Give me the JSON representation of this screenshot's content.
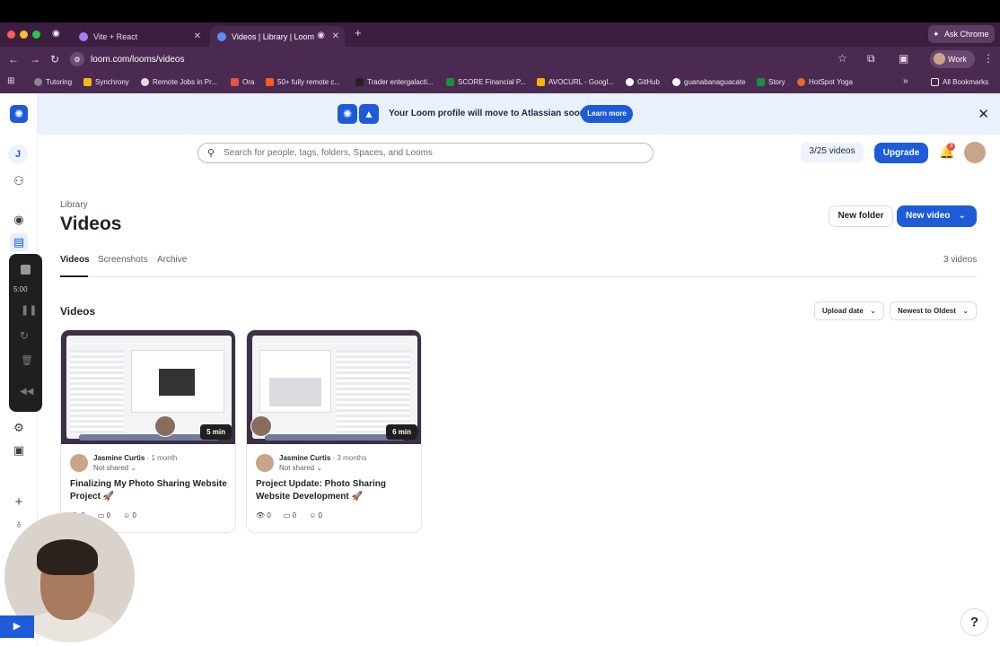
{
  "browser": {
    "tabs": [
      {
        "label": "Vite + React"
      },
      {
        "label": "Videos | Library | Loom"
      }
    ],
    "url": "loom.com/looms/videos",
    "ask_chrome": "Ask Chrome",
    "profile": "Work",
    "bookmarks": [
      "Tutoring",
      "Synchrony",
      "Remote Jobs in Pr...",
      "Ora",
      "50+ fully remote c...",
      "Trader entergalacti...",
      "SCORE Financial P...",
      "AVOCURL - Googl...",
      "GitHub",
      "guanabanaguacate",
      "Story",
      "HotSpot Yoga"
    ],
    "all_bookmarks": "All Bookmarks"
  },
  "rail": {
    "user_initial": "J",
    "timer": "5:00"
  },
  "banner": {
    "message": "Your Loom profile will move to Atlassian soon.",
    "learn_more": "Learn more"
  },
  "header": {
    "search_placeholder": "Search for people, tags, folders, Spaces, and Looms",
    "videos_quota": "3/25 videos",
    "upgrade": "Upgrade",
    "notification_count": "3"
  },
  "page": {
    "breadcrumb": "Library",
    "title": "Videos",
    "new_folder": "New folder",
    "new_video": "New video",
    "subtabs": [
      "Videos",
      "Screenshots",
      "Archive"
    ],
    "count_label": "3 videos",
    "section_title": "Videos",
    "sort_by": "Upload date",
    "sort_order": "Newest to Oldest"
  },
  "videos": [
    {
      "duration": "5 min",
      "author": "Jasmine Curtis",
      "when": "1 month",
      "sharing": "Not shared",
      "title": "Finalizing My Photo Sharing Website Project 🚀",
      "views": "0",
      "comments": "0",
      "reactions": "0"
    },
    {
      "duration": "6 min",
      "author": "Jasmine Curtis",
      "when": "3 months",
      "sharing": "Not shared",
      "title": "Project Update: Photo Sharing Website Development 🚀",
      "views": "0",
      "comments": "0",
      "reactions": "0"
    }
  ],
  "help": "?",
  "colors": {
    "brand_blue": "#1d5bd8",
    "chrome_purple": "#4b2a52",
    "banner_bg": "#e8f1fc"
  }
}
